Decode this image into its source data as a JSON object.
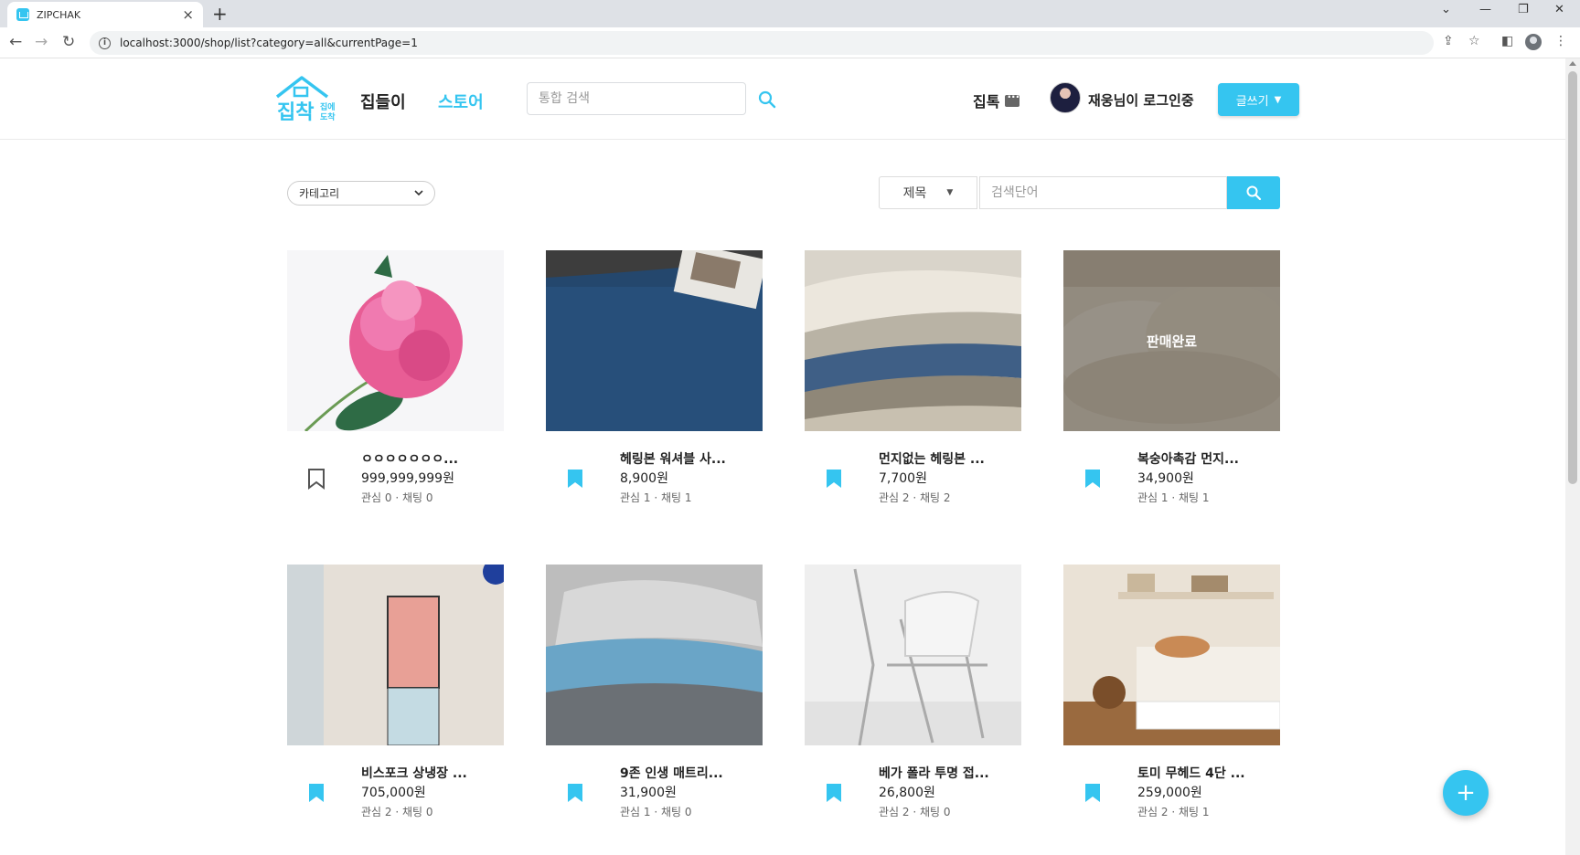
{
  "browser": {
    "tab_title": "ZIPCHAK",
    "url": "localhost:3000/shop/list?category=all&currentPage=1"
  },
  "header": {
    "logo_text": "집착",
    "logo_sub": "집에 도착",
    "nav_home": "집들이",
    "nav_store": "스토어",
    "search_placeholder": "통합 검색",
    "chat_label": "집톡",
    "user_label": "재웅님이 로그인중",
    "write_label": "글쓰기"
  },
  "filters": {
    "category_label": "카테고리",
    "search_type": "제목",
    "search_placeholder": "검색단어"
  },
  "colors": {
    "accent": "#35c5f0"
  },
  "products": [
    {
      "title": "ㅇㅇㅇㅇㅇㅇㅇ...",
      "price": "999,999,999원",
      "meta": "관심 0 · 채팅 0",
      "bookmarked": false,
      "sold_out": false
    },
    {
      "title": "헤링본 워셔블 사...",
      "price": "8,900원",
      "meta": "관심 1 · 채팅 1",
      "bookmarked": true,
      "sold_out": false
    },
    {
      "title": "먼지없는 헤링본 ...",
      "price": "7,700원",
      "meta": "관심 2 · 채팅 2",
      "bookmarked": true,
      "sold_out": false
    },
    {
      "title": "복숭아촉감 먼지...",
      "price": "34,900원",
      "meta": "관심 1 · 채팅 1",
      "bookmarked": true,
      "sold_out": true,
      "sold_out_label": "판매완료"
    },
    {
      "title": "비스포크 상냉장 ...",
      "price": "705,000원",
      "meta": "관심 2 · 채팅 0",
      "bookmarked": true,
      "sold_out": false
    },
    {
      "title": "9존 인생 매트리...",
      "price": "31,900원",
      "meta": "관심 1 · 채팅 0",
      "bookmarked": true,
      "sold_out": false
    },
    {
      "title": "베가 폴라 투명 접...",
      "price": "26,800원",
      "meta": "관심 2 · 채팅 0",
      "bookmarked": true,
      "sold_out": false
    },
    {
      "title": "토미 무헤드 4단 ...",
      "price": "259,000원",
      "meta": "관심 2 · 채팅 1",
      "bookmarked": true,
      "sold_out": false
    }
  ]
}
